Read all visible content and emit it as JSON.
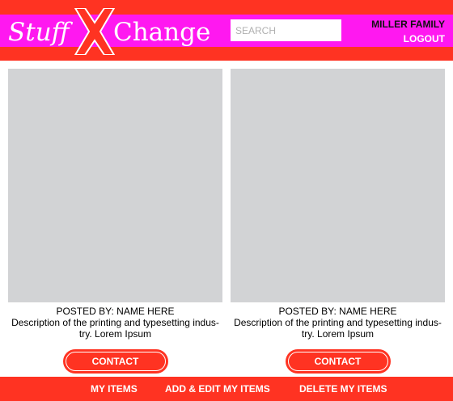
{
  "brand": {
    "word_left": "Stuff",
    "word_right": "Change",
    "colors": {
      "header_red": "#ff3322",
      "brand_magenta": "#ff18f0",
      "image_placeholder": "#d2d3d5"
    }
  },
  "header": {
    "search_placeholder": "SEARCH",
    "user_name": "MILLER FAMILY",
    "logout_label": "LOGOUT"
  },
  "items": [
    {
      "posted_by": "POSTED BY: NAME HERE",
      "description": "Description of the printing and typesetting indus-try. Lorem Ipsum",
      "contact_label": "CONTACT"
    },
    {
      "posted_by": "POSTED BY: NAME HERE",
      "description": "Description of the printing and typesetting indus-try. Lorem Ipsum",
      "contact_label": "CONTACT"
    }
  ],
  "footer": {
    "nav": [
      "MY ITEMS",
      "ADD & EDIT MY ITEMS",
      "DELETE MY ITEMS"
    ]
  }
}
